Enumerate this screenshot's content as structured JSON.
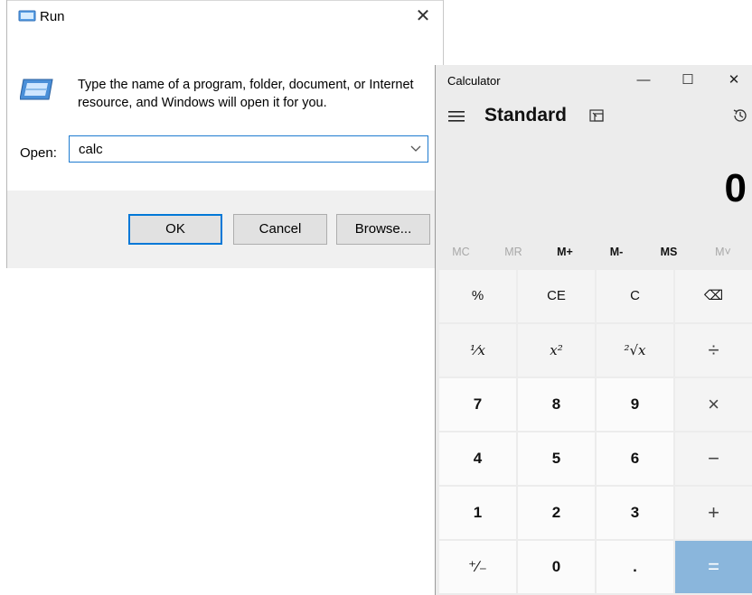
{
  "run_dialog": {
    "title": "Run",
    "description": "Type the name of a program, folder, document, or Internet resource, and Windows will open it for you.",
    "open_label": "Open:",
    "open_value": "calc",
    "buttons": {
      "ok": "OK",
      "cancel": "Cancel",
      "browse": "Browse..."
    },
    "close_glyph": "✕"
  },
  "calculator": {
    "title": "Calculator",
    "window_controls": {
      "minimize": "—",
      "maximize": "☐",
      "close": "✕"
    },
    "mode": "Standard",
    "display_value": "0",
    "memory_buttons": [
      {
        "label": "MC",
        "enabled": false
      },
      {
        "label": "MR",
        "enabled": false
      },
      {
        "label": "M+",
        "enabled": true
      },
      {
        "label": "M-",
        "enabled": true
      },
      {
        "label": "MS",
        "enabled": true
      },
      {
        "label": "M˅",
        "enabled": false
      }
    ],
    "keys": {
      "percent": "%",
      "clear_entry": "CE",
      "clear": "C",
      "backspace": "⌫",
      "reciprocal": "¹⁄x",
      "square": "x²",
      "square_root": "²√x",
      "divide": "÷",
      "seven": "7",
      "eight": "8",
      "nine": "9",
      "multiply": "×",
      "four": "4",
      "five": "5",
      "six": "6",
      "subtract": "−",
      "one": "1",
      "two": "2",
      "three": "3",
      "add": "+",
      "negate": "⁺∕₋",
      "zero": "0",
      "decimal": ".",
      "equals": "="
    }
  },
  "colors": {
    "focus_blue": "#0078d7",
    "equals_key": "#8ab6dc",
    "calc_background": "#ececec"
  }
}
